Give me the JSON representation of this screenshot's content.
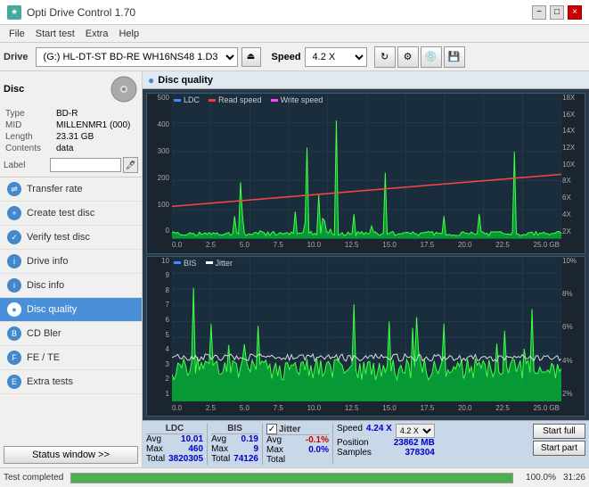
{
  "app": {
    "title": "Opti Drive Control 1.70",
    "icon": "★"
  },
  "titlebar": {
    "title": "Opti Drive Control 1.70",
    "minimize_label": "−",
    "maximize_label": "□",
    "close_label": "×"
  },
  "menubar": {
    "items": [
      "File",
      "Start test",
      "Extra",
      "Help"
    ]
  },
  "drivebar": {
    "label": "Drive",
    "drive_value": "(G:)  HL-DT-ST BD-RE  WH16NS48 1.D3",
    "speed_label": "Speed",
    "speed_value": "4.2 X"
  },
  "disc": {
    "header": "Disc",
    "type_label": "Type",
    "type_value": "BD-R",
    "mid_label": "MID",
    "mid_value": "MILLENMR1 (000)",
    "length_label": "Length",
    "length_value": "23.31 GB",
    "contents_label": "Contents",
    "contents_value": "data",
    "label_label": "Label",
    "label_value": ""
  },
  "nav": {
    "items": [
      {
        "id": "transfer-rate",
        "label": "Transfer rate",
        "active": false
      },
      {
        "id": "create-test-disc",
        "label": "Create test disc",
        "active": false
      },
      {
        "id": "verify-test-disc",
        "label": "Verify test disc",
        "active": false
      },
      {
        "id": "drive-info",
        "label": "Drive info",
        "active": false
      },
      {
        "id": "disc-info",
        "label": "Disc info",
        "active": false
      },
      {
        "id": "disc-quality",
        "label": "Disc quality",
        "active": true
      },
      {
        "id": "cd-bler",
        "label": "CD Bler",
        "active": false
      },
      {
        "id": "fe-te",
        "label": "FE / TE",
        "active": false
      },
      {
        "id": "extra-tests",
        "label": "Extra tests",
        "active": false
      }
    ],
    "status_btn": "Status window >>"
  },
  "chart": {
    "title": "Disc quality",
    "icon": "●",
    "top": {
      "legend": [
        {
          "label": "LDC",
          "color": "#0088ff"
        },
        {
          "label": "Read speed",
          "color": "#ff0000"
        },
        {
          "label": "Write speed",
          "color": "#ff00ff"
        }
      ],
      "y_left": [
        "500",
        "400",
        "300",
        "200",
        "100",
        "0"
      ],
      "y_right": [
        "18X",
        "16X",
        "14X",
        "12X",
        "10X",
        "8X",
        "6X",
        "4X",
        "2X"
      ],
      "x_labels": [
        "0.0",
        "2.5",
        "5.0",
        "7.5",
        "10.0",
        "12.5",
        "15.0",
        "17.5",
        "20.0",
        "22.5",
        "25.0 GB"
      ]
    },
    "bottom": {
      "legend": [
        {
          "label": "BIS",
          "color": "#0088ff"
        },
        {
          "label": "Jitter",
          "color": "#ffffff"
        }
      ],
      "y_left": [
        "10",
        "9",
        "8",
        "7",
        "6",
        "5",
        "4",
        "3",
        "2",
        "1"
      ],
      "y_right": [
        "10%",
        "8%",
        "6%",
        "4%",
        "2%"
      ],
      "x_labels": [
        "0.0",
        "2.5",
        "5.0",
        "7.5",
        "10.0",
        "12.5",
        "15.0",
        "17.5",
        "20.0",
        "22.5",
        "25.0 GB"
      ]
    }
  },
  "stats": {
    "columns": [
      {
        "header": "LDC",
        "rows": [
          {
            "label": "Avg",
            "value": "10.01"
          },
          {
            "label": "Max",
            "value": "460"
          },
          {
            "label": "Total",
            "value": "3820305"
          }
        ]
      },
      {
        "header": "BIS",
        "rows": [
          {
            "label": "Avg",
            "value": "0.19"
          },
          {
            "label": "Max",
            "value": "9"
          },
          {
            "label": "Total",
            "value": "74126"
          }
        ]
      },
      {
        "header": "Jitter",
        "rows": [
          {
            "label": "Avg",
            "value": "-0.1%"
          },
          {
            "label": "Max",
            "value": "0.0%"
          },
          {
            "label": "Total",
            "value": ""
          }
        ]
      }
    ],
    "speed_label": "Speed",
    "speed_value": "4.24 X",
    "speed_select": "4.2 X",
    "position_label": "Position",
    "position_value": "23862 MB",
    "samples_label": "Samples",
    "samples_value": "378304",
    "start_full_label": "Start full",
    "start_part_label": "Start part"
  },
  "statusbar": {
    "text": "Test completed",
    "progress": 100,
    "progress_label": "100.0%",
    "time": "31:26"
  },
  "colors": {
    "accent_blue": "#4a90d9",
    "nav_active": "#4a90d9",
    "ldc_color": "#4488ff",
    "bis_color": "#44ff44",
    "read_speed_color": "#ff3333",
    "jitter_color": "#ffffff",
    "chart_bg": "#1e3040",
    "grid_color": "#2a4050"
  }
}
